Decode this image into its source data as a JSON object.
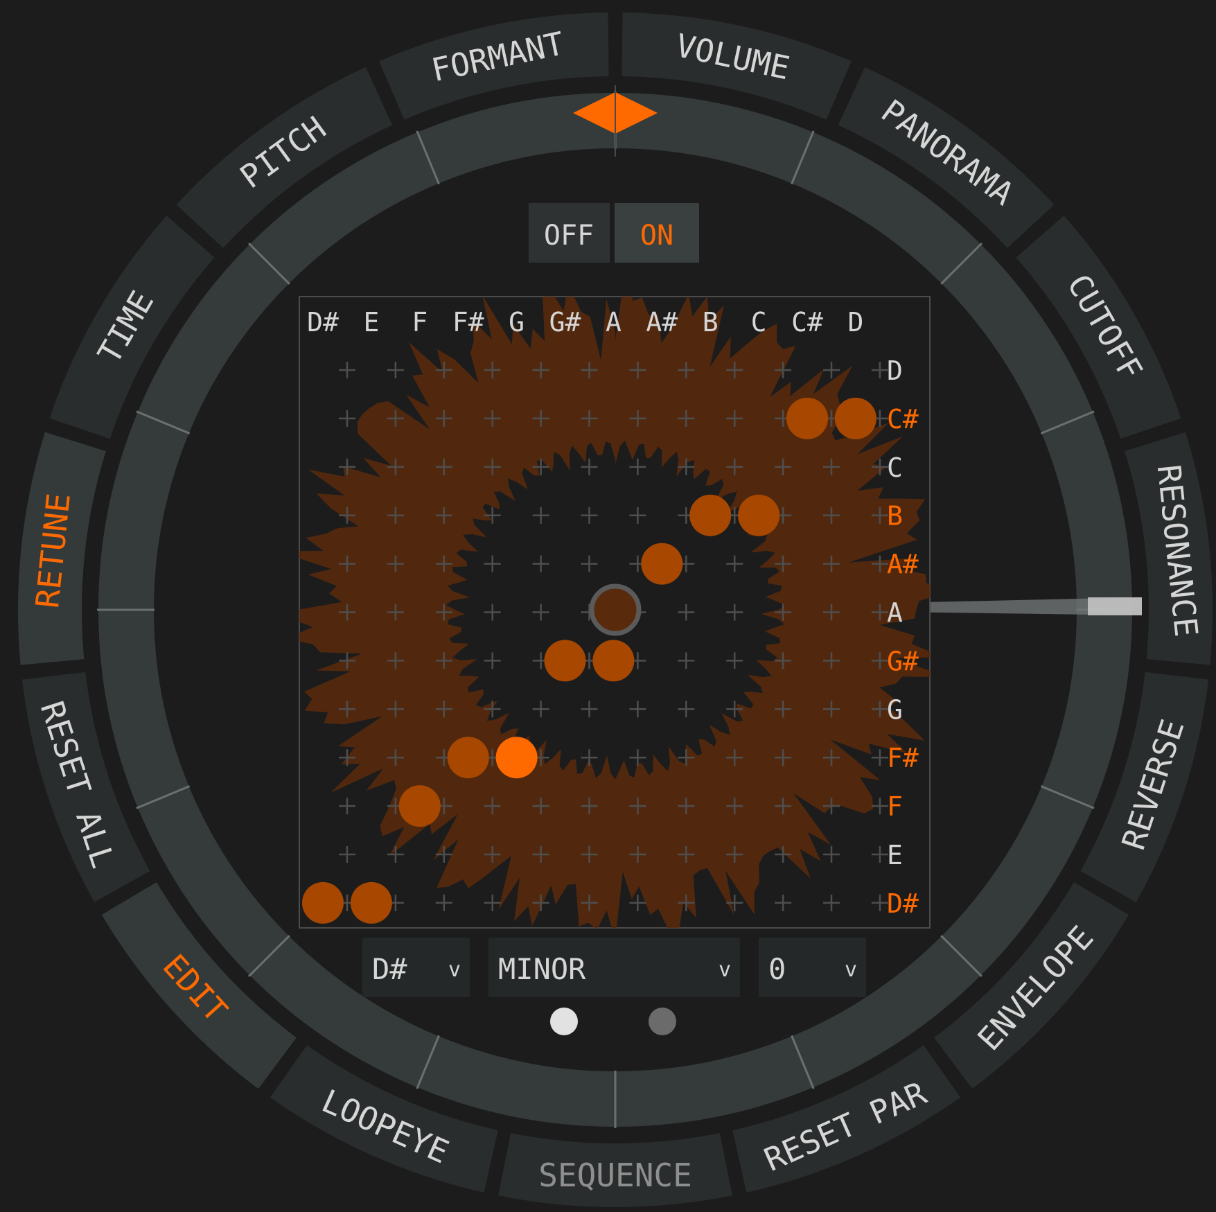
{
  "colors": {
    "background": "#1c1c1c",
    "panel": "#2a2d2d",
    "ring": "#363c3c",
    "accent": "#ff6a00",
    "dot": "#a84800",
    "label_inactive": "#d6d6d6",
    "label_dim": "#8f8f8f"
  },
  "mode_tabs": [
    {
      "label": "VOLUME",
      "active": false
    },
    {
      "label": "PANORAMA",
      "active": false
    },
    {
      "label": "CUTOFF",
      "active": false
    },
    {
      "label": "RESONANCE",
      "active": false
    },
    {
      "label": "REVERSE",
      "active": false
    },
    {
      "label": "ENVELOPE",
      "active": false
    },
    {
      "label": "RESET PAR",
      "active": false
    },
    {
      "label": "SEQUENCE",
      "active": false
    },
    {
      "label": "LOOPEYE",
      "active": false
    },
    {
      "label": "EDIT",
      "active": true
    },
    {
      "label": "RESET ALL",
      "active": false
    },
    {
      "label": "RETUNE",
      "active": true
    },
    {
      "label": "TIME",
      "active": false
    },
    {
      "label": "PITCH",
      "active": false
    },
    {
      "label": "FORMANT",
      "active": false
    }
  ],
  "toggle": {
    "off_label": "OFF",
    "on_label": "ON",
    "selected": "ON"
  },
  "grid": {
    "columns": [
      "D#",
      "E",
      "F",
      "F#",
      "G",
      "G#",
      "A",
      "A#",
      "B",
      "C",
      "C#",
      "D"
    ],
    "rows": [
      {
        "label": "D",
        "in_scale": false
      },
      {
        "label": "C#",
        "in_scale": true
      },
      {
        "label": "C",
        "in_scale": false
      },
      {
        "label": "B",
        "in_scale": true
      },
      {
        "label": "A#",
        "in_scale": true
      },
      {
        "label": "A",
        "in_scale": false
      },
      {
        "label": "G#",
        "in_scale": true
      },
      {
        "label": "G",
        "in_scale": false
      },
      {
        "label": "F#",
        "in_scale": true
      },
      {
        "label": "F",
        "in_scale": true
      },
      {
        "label": "E",
        "in_scale": false
      },
      {
        "label": "D#",
        "in_scale": true
      }
    ],
    "mappings": [
      {
        "input": "C#",
        "output": "C#",
        "active": false
      },
      {
        "input": "D",
        "output": "C#",
        "active": false
      },
      {
        "input": "B",
        "output": "B",
        "active": false
      },
      {
        "input": "C",
        "output": "B",
        "active": false
      },
      {
        "input": "A#",
        "output": "A#",
        "active": false
      },
      {
        "input": "G#",
        "output": "G#",
        "active": false
      },
      {
        "input": "A",
        "output": "G#",
        "active": false
      },
      {
        "input": "F#",
        "output": "F#",
        "active": false
      },
      {
        "input": "G",
        "output": "F#",
        "active": true
      },
      {
        "input": "F",
        "output": "F",
        "active": false
      },
      {
        "input": "D#",
        "output": "D#",
        "active": false
      },
      {
        "input": "E",
        "output": "D#",
        "active": false
      }
    ]
  },
  "selectors": {
    "key": {
      "value": "D#",
      "icon": "chevron-down-icon",
      "glyph": "v"
    },
    "scale": {
      "value": "MINOR",
      "icon": "chevron-down-icon",
      "glyph": "v"
    },
    "offset": {
      "value": "0",
      "icon": "chevron-down-icon",
      "glyph": "v"
    }
  },
  "page_dots": [
    {
      "active": true
    },
    {
      "active": false
    }
  ]
}
